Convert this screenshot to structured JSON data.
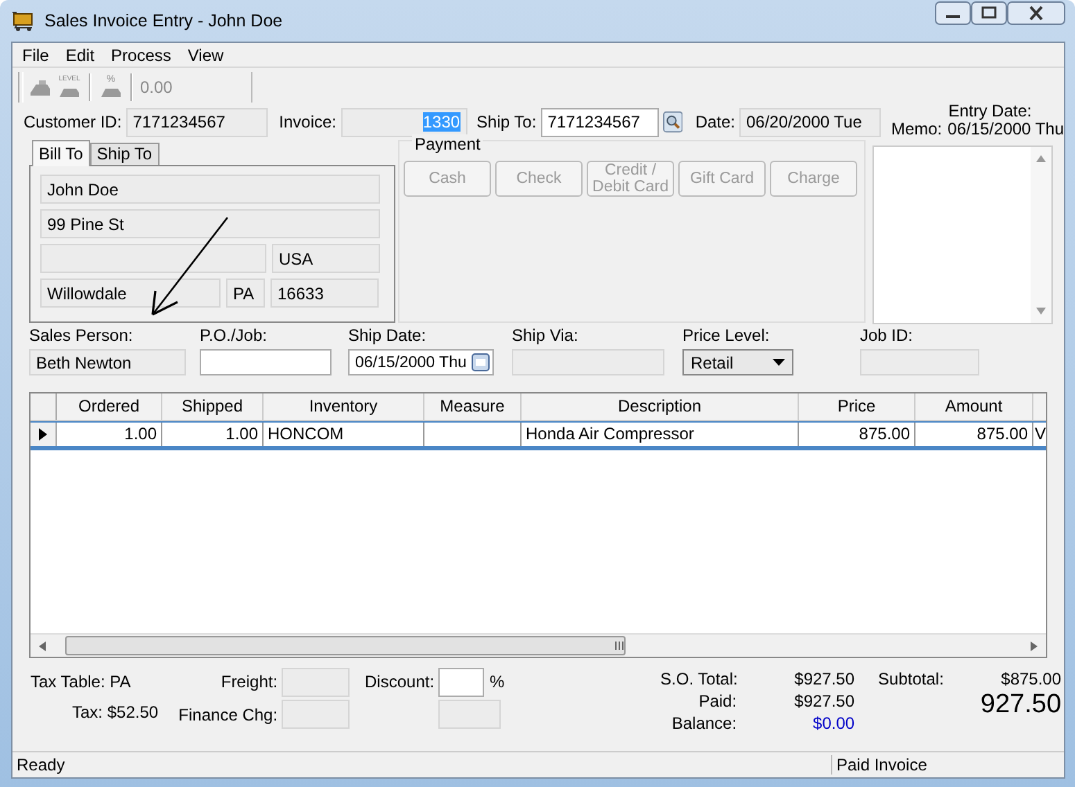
{
  "window": {
    "title": "Sales Invoice Entry - John Doe"
  },
  "menu": [
    {
      "label": "File"
    },
    {
      "label": "Edit"
    },
    {
      "label": "Process"
    },
    {
      "label": "View"
    }
  ],
  "toolbar": {
    "level_caption": "LEVEL",
    "percent_caption": "%",
    "reading": "0.00"
  },
  "header": {
    "customer_id": {
      "label": "Customer ID:",
      "value": "7171234567"
    },
    "invoice": {
      "label": "Invoice:",
      "value": "1330",
      "selected": true
    },
    "ship_to": {
      "label": "Ship To:",
      "value": "7171234567"
    },
    "date": {
      "label": "Date:",
      "value": "06/20/2000 Tue"
    },
    "entry_date_label": "Entry Date:",
    "memo_label": "Memo:",
    "entry_date": "06/15/2000 Thu"
  },
  "address_tabs": [
    {
      "label": "Bill To",
      "selected": true
    },
    {
      "label": "Ship To",
      "selected": false
    }
  ],
  "address": {
    "name": "John Doe",
    "street": "99 Pine St",
    "country": "USA",
    "city": "Willowdale",
    "state": "PA",
    "zip": "16633"
  },
  "payment": {
    "title": "Payment",
    "buttons": [
      {
        "label": "Cash",
        "disabled": true
      },
      {
        "label": "Check",
        "disabled": true
      },
      {
        "label": "Credit / Debit Card",
        "disabled": true
      },
      {
        "label": "Gift Card",
        "disabled": true
      },
      {
        "label": "Charge",
        "disabled": true
      }
    ]
  },
  "order_fields": [
    {
      "kind": "text",
      "label": "Sales Person:",
      "value": "Beth Newton",
      "editable": false
    },
    {
      "kind": "text",
      "label": "P.O./Job:",
      "editable": true
    },
    {
      "kind": "date",
      "label": "Ship Date:",
      "value": "06/15/2000 Thu",
      "editable": true
    },
    {
      "kind": "text",
      "label": "Ship Via:",
      "editable": false
    },
    {
      "kind": "dropdown",
      "label": "Price Level:",
      "value": "Retail",
      "editable": true
    },
    {
      "kind": "text",
      "label": "Job ID:",
      "editable": false
    }
  ],
  "table": {
    "columns": [
      "Ordered",
      "Shipped",
      "Inventory",
      "Measure",
      "Description",
      "Price",
      "Amount"
    ],
    "rows": [
      {
        "current": true,
        "cells": [
          "1.00",
          "1.00",
          "HONCOM",
          "",
          "Honda Air Compressor",
          "875.00",
          "875.00",
          "V"
        ]
      }
    ]
  },
  "totals": {
    "tax_table": "Tax Table: PA",
    "tax": "Tax: $52.50",
    "freight_label": "Freight:",
    "discount_label": "Discount:",
    "percent": "%",
    "finance_label": "Finance Chg:",
    "so_total_label": "S.O. Total:",
    "so_total": "$927.50",
    "paid_label": "Paid:",
    "paid": "$927.50",
    "balance_label": "Balance:",
    "balance": "$0.00",
    "subtotal_label": "Subtotal:",
    "subtotal": "$875.00",
    "grand_total": "927.50"
  },
  "status_bar": [
    "Ready",
    "Paid Invoice"
  ]
}
